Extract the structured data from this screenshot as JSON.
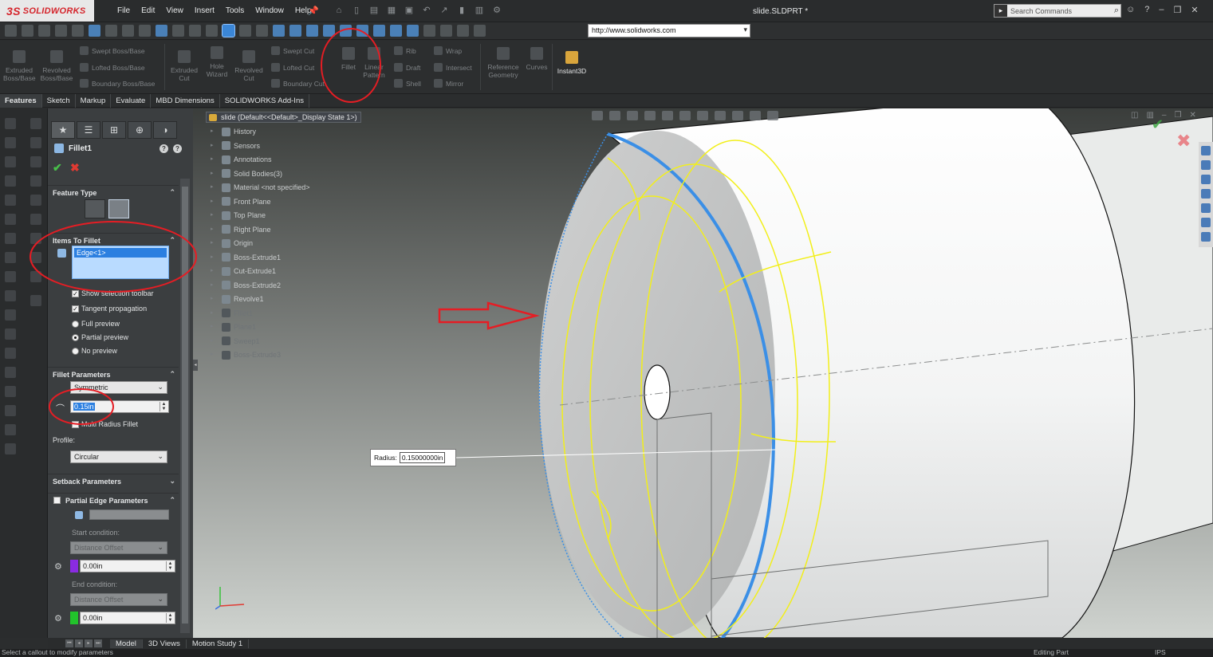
{
  "app": {
    "brand_mark": "3S",
    "brand_name": "SOLIDWORKS",
    "document_title": "slide.SLDPRT *",
    "menu": [
      "File",
      "Edit",
      "View",
      "Insert",
      "Tools",
      "Window",
      "Help"
    ],
    "search_placeholder": "Search Commands",
    "url": "http://www.solidworks.com",
    "icons": {
      "search": "search-icon",
      "user": "user-icon",
      "help": "help-icon",
      "minimize": "minimize-icon",
      "restore": "restore-icon",
      "close": "close-icon"
    }
  },
  "ribbon": {
    "extruded_boss": "Extruded Boss/Base",
    "revolved_boss": "Revolved Boss/Base",
    "swept_boss": "Swept Boss/Base",
    "lofted_boss": "Lofted Boss/Base",
    "boundary_boss": "Boundary Boss/Base",
    "extruded_cut": "Extruded Cut",
    "hole_wizard": "Hole Wizard",
    "revolved_cut": "Revolved Cut",
    "swept_cut": "Swept Cut",
    "lofted_cut": "Lofted Cut",
    "boundary_cut": "Boundary Cut",
    "fillet": "Fillet",
    "linear_pattern": "Linear Pattern",
    "rib": "Rib",
    "draft": "Draft",
    "shell": "Shell",
    "wrap": "Wrap",
    "intersect": "Intersect",
    "mirror": "Mirror",
    "reference_geometry": "Reference Geometry",
    "curves": "Curves",
    "instant3d": "Instant3D"
  },
  "tabs": [
    "Features",
    "Sketch",
    "Markup",
    "Evaluate",
    "MBD Dimensions",
    "SOLIDWORKS Add-Ins"
  ],
  "property_manager": {
    "title": "Fillet1",
    "feature_type": "Feature Type",
    "items_to_fillet": "Items To Fillet",
    "selected_item": "Edge<1>",
    "show_selection_toolbar": "Show selection toolbar",
    "tangent_propagation": "Tangent propagation",
    "full_preview": "Full preview",
    "partial_preview": "Partial preview",
    "no_preview": "No preview",
    "fillet_parameters": "Fillet Parameters",
    "method": "Symmetric",
    "radius": "0.15in",
    "multi_radius": "Multi Radius Fillet",
    "profile_label": "Profile:",
    "profile": "Circular",
    "setback_parameters": "Setback Parameters",
    "partial_edge_parameters": "Partial Edge Parameters",
    "start_condition_label": "Start condition:",
    "start_condition": "Distance Offset",
    "start_value": "0.00in",
    "end_condition_label": "End condition:",
    "end_condition": "Distance Offset",
    "end_value": "0.00in",
    "start_color": "#8a2be2",
    "end_color": "#22c32b"
  },
  "tree": {
    "root": "slide  (Default<<Default>_Display State 1>)",
    "items": [
      {
        "label": "History",
        "dim": false
      },
      {
        "label": "Sensors",
        "dim": false
      },
      {
        "label": "Annotations",
        "dim": false
      },
      {
        "label": "Solid Bodies(3)",
        "dim": false
      },
      {
        "label": "Material <not specified>",
        "dim": false
      },
      {
        "label": "Front Plane",
        "dim": false
      },
      {
        "label": "Top Plane",
        "dim": false
      },
      {
        "label": "Right Plane",
        "dim": false
      },
      {
        "label": "Origin",
        "dim": false
      },
      {
        "label": "Boss-Extrude1",
        "dim": false
      },
      {
        "label": "Cut-Extrude1",
        "dim": false
      },
      {
        "label": "Boss-Extrude2",
        "dim": false
      },
      {
        "label": "Revolve1",
        "dim": false
      },
      {
        "label": "Fillet1",
        "dim": true
      },
      {
        "label": "Plane1",
        "dim": true
      },
      {
        "label": "Sweep1",
        "dim": true
      },
      {
        "label": "Boss-Extrude3",
        "dim": true
      }
    ]
  },
  "viewport": {
    "radius_label": "Radius:",
    "radius_value": "0.15000000in",
    "selection_color": "#3b8fe6",
    "preview_color": "#f2ef1a",
    "annotation_color": "#e51d24"
  },
  "bottom_tabs": [
    "Model",
    "3D Views",
    "Motion Study 1"
  ],
  "status": {
    "hint": "Select a callout to modify parameters",
    "mode": "Editing Part",
    "units": "IPS"
  }
}
